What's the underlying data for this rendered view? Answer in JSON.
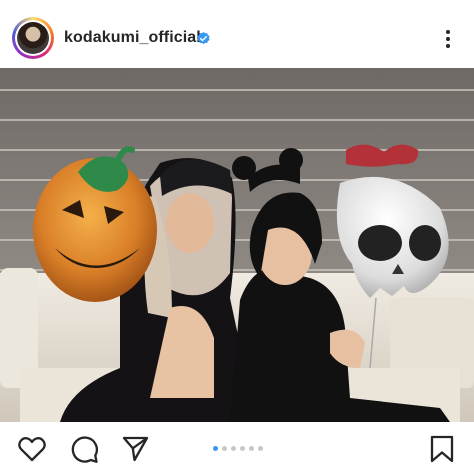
{
  "post": {
    "username": "kodakumi_official",
    "verified": true
  },
  "icons": {
    "avatar": "profile-avatar",
    "verified": "verified-badge-icon",
    "more": "more-options-icon",
    "like": "heart-icon",
    "comment": "comment-icon",
    "share": "share-icon",
    "save": "bookmark-icon"
  },
  "carousel": {
    "total": 6,
    "current": 1
  },
  "colors": {
    "accent": "#3897f0",
    "verified": "#3897f0",
    "text": "#262626",
    "inactive_dot": "#c7c7c7"
  }
}
